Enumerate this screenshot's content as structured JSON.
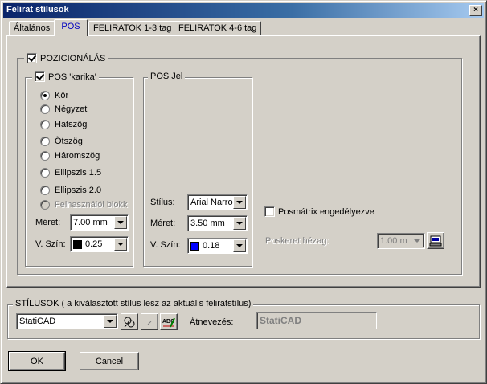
{
  "window": {
    "title": "Felirat stílusok",
    "close_symbol": "×"
  },
  "tabs": [
    {
      "label": "Általános",
      "active": false
    },
    {
      "label": "POS",
      "active": true
    },
    {
      "label": "FELIRATOK 1-3 tag",
      "active": false
    },
    {
      "label": "FELIRATOK 4-6 tag",
      "active": false
    }
  ],
  "pozicionalas": {
    "label": "POZICIONÁLÁS",
    "checked": true,
    "karika": {
      "label": "POS 'karika'",
      "checked": true,
      "shapes": [
        {
          "label": "Kör",
          "selected": true
        },
        {
          "label": "Négyzet",
          "selected": false
        },
        {
          "label": "Hatszög",
          "selected": false
        },
        {
          "label": "Ötszög",
          "selected": false
        },
        {
          "label": "Háromszög",
          "selected": false
        },
        {
          "label": "Ellipszis 1.5",
          "selected": false
        },
        {
          "label": "Ellipszis 2.0",
          "selected": false
        },
        {
          "label": "Felhasználói blokk",
          "selected": false,
          "disabled": true
        }
      ],
      "meret_label": "Méret:",
      "meret_value": "7.00 mm",
      "vszin_label": "V. Szín:",
      "vszin_value": "0.25",
      "vszin_color": "#000000"
    },
    "jel": {
      "label": "POS Jel",
      "stilus_label": "Stílus:",
      "stilus_value": "Arial Narro",
      "meret_label": "Méret:",
      "meret_value": "3.50 mm",
      "vszin_label": "V. Szín:",
      "vszin_value": "0.18",
      "vszin_color": "#0000ff"
    },
    "posmatrix_label": "Posmátrix engedélyezve",
    "posmatrix_checked": false,
    "poskeret_label": "Poskeret hézag:",
    "poskeret_value": "1.00 m"
  },
  "stilusok": {
    "label": "STÍLUSOK ( a kiválasztott stílus lesz az aktuális feliratstílus)",
    "selected": "StatiCAD",
    "rename_label": "Átnevezés:",
    "rename_value": "StatiCAD",
    "tool3_text": "ABC"
  },
  "buttons": {
    "ok": "OK",
    "cancel": "Cancel"
  }
}
